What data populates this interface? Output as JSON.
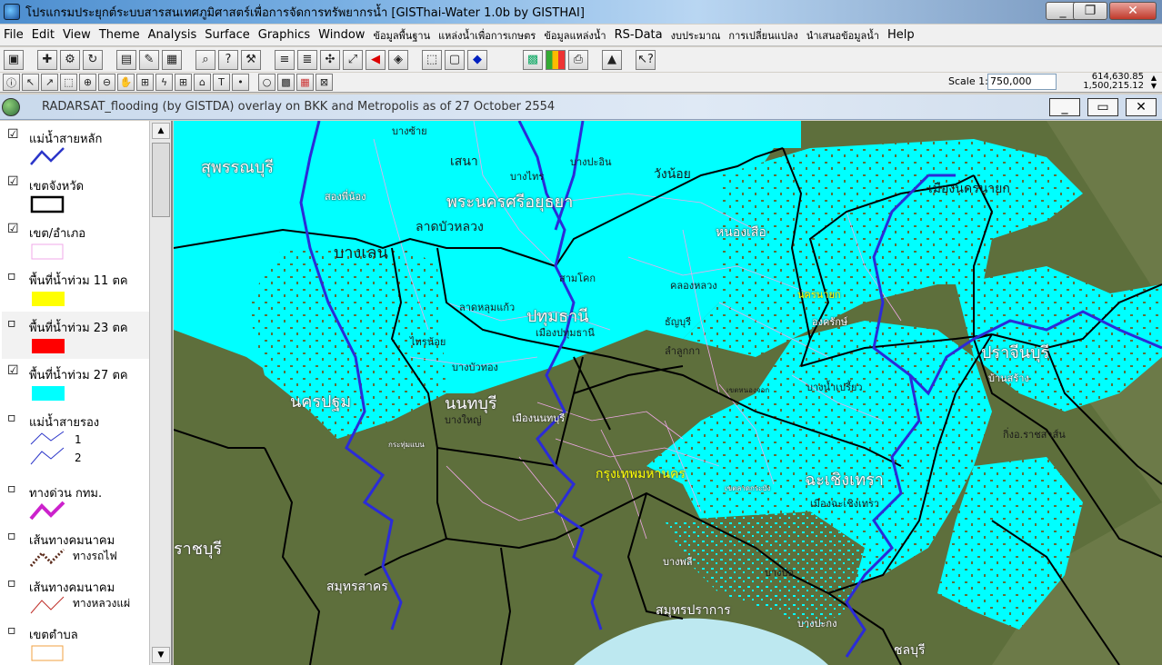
{
  "app": {
    "title": "โปรแกรมประยุกต์ระบบสารสนเทศภูมิศาสตร์เพื่อการจัดการทรัพยากรน้ำ  [GISThai-Water 1.0b   by GISTHAI]",
    "window_buttons": {
      "minimize": "_",
      "restore": "❐",
      "close": "✕"
    }
  },
  "menu": [
    "File",
    "Edit",
    "View",
    "Theme",
    "Analysis",
    "Surface",
    "Graphics",
    "Window",
    "ข้อมูลพื้นฐาน",
    "แหล่งน้ำเพื่อการเกษตร",
    "ข้อมูลแหล่งน้ำ",
    "RS-Data",
    "งบประมาณ",
    "การเปลี่ยนแปลง",
    "นำเสนอข้อมูลน้ำ",
    "Help"
  ],
  "toolbar": {
    "scale_label": "Scale 1:",
    "scale_value": "750,000",
    "coord_x": "614,630.85",
    "coord_y": "1,500,215.12"
  },
  "document": {
    "title": "RADARSAT_flooding (by GISTDA) overlay on BKK and Metropolis as of 27 October 2554"
  },
  "legend": {
    "items": [
      {
        "label": "แม่น้ำสายหลัก",
        "checked": true,
        "symbol": "blue-line",
        "color": "#2b35c9"
      },
      {
        "label": "เขตจังหวัด",
        "checked": true,
        "symbol": "black-box",
        "color": "#000000"
      },
      {
        "label": "เขต/อำเภอ",
        "checked": true,
        "symbol": "pink-box",
        "color": "#f0a8e8"
      },
      {
        "label": "พื้นที่น้ำท่วม 11 ตค",
        "checked": false,
        "symbol": "fill",
        "color": "#ffff00"
      },
      {
        "label": "พื้นที่น้ำท่วม 23 ตค",
        "checked": false,
        "symbol": "fill",
        "color": "#ff0000"
      },
      {
        "label": "พื้นที่น้ำท่วม 27 ตค",
        "checked": true,
        "symbol": "fill",
        "color": "#00ffff"
      },
      {
        "label": "แม่น้ำสายรอง",
        "checked": false,
        "symbol": "two-lines",
        "color": "#2b35c9",
        "subs": [
          "1",
          "2"
        ]
      },
      {
        "label": "ทางด่วน กทม.",
        "checked": false,
        "symbol": "magenta-line",
        "color": "#cc22cc"
      },
      {
        "label": "เส้นทางคมนาคม",
        "checked": false,
        "symbol": "rail",
        "color": "#5a2a1a",
        "sub": "ทางรถไฟ"
      },
      {
        "label": "เส้นทางคมนาคม",
        "checked": false,
        "symbol": "red-line",
        "color": "#c0302a",
        "sub": "ทางหลวงแผ่"
      },
      {
        "label": "เขตตำบล",
        "checked": false,
        "symbol": "orange-box",
        "color": "#f0a040"
      }
    ]
  },
  "map": {
    "colors": {
      "flood": "#00ffff",
      "land": "#5e6f3c",
      "sea": "#bde8f0",
      "river": "#2b2bd8",
      "boundary": "#000000",
      "district": "#f0a8e8"
    },
    "labels": {
      "suphanburi": "สุพรรณบุรี",
      "ayutthaya": "พระนครศรีอยุธยา",
      "nakhon_nayok_prov": "เมืองนครนายก",
      "nakhon_nayok": "นครนายก",
      "bang_len": "บางเลน",
      "pathum_thani": "ปทุมธานี",
      "nakhon_pathom": "นครปฐม",
      "nonthaburi": "นนทบุรี",
      "prachinburi": "ปราจีนบุรี",
      "bangkok": "กรุงเทพมหานคร",
      "chachoengsao": "ฉะเชิงเทรา",
      "ratchaburi": "ราชบุรี",
      "samut_sakhon": "สมุทรสาคร",
      "samut_prakan": "สมุทรปราการ",
      "chonburi": "ชลบุรี",
      "bang_sai": "บางซ้าย",
      "sena": "เสนา",
      "bang_pa_in": "บางปะอิน",
      "bang_sai2": "บางไทร",
      "wang_noi": "วังน้อย",
      "song_phi_nong": "สองพี่น้อง",
      "lat_bua_luang": "ลาดบัวหลวง",
      "nong_suea": "หนองเสือ",
      "sam_khok": "สามโคก",
      "khlong_luang": "คลองหลวง",
      "lat_lum_kaeo": "ลาดหลุมแก้ว",
      "thanyaburi": "ธัญบุรี",
      "ongkharak": "องครักษ์",
      "mueang_pathum": "เมืองปทุมธานี",
      "lam_luk_ka": "ลำลูกกา",
      "sai_noi": "ไทรน้อย",
      "bang_bua_thong": "บางบัวทอง",
      "ban_sang": "บ้านสร้าง",
      "bang_nam_priao": "บางน้ำเปรี้ยว",
      "bang_yai": "บางใหญ่",
      "kabin": "กิ่งอ.ราชสาส์น",
      "mueang_non": "เมืองนนทบุรี",
      "krathum_baen": "กระทุ่มแบน",
      "nong_chok": "เขตหนองจอก",
      "lat_krabang": "เขตลาดกระบัง",
      "mueang_chachoeng": "เมืองฉะเชิงเทรา",
      "bang_phli": "บางพลี",
      "bang_bo": "บางบ่อ",
      "bang_pakong": "บางปะกง"
    }
  }
}
